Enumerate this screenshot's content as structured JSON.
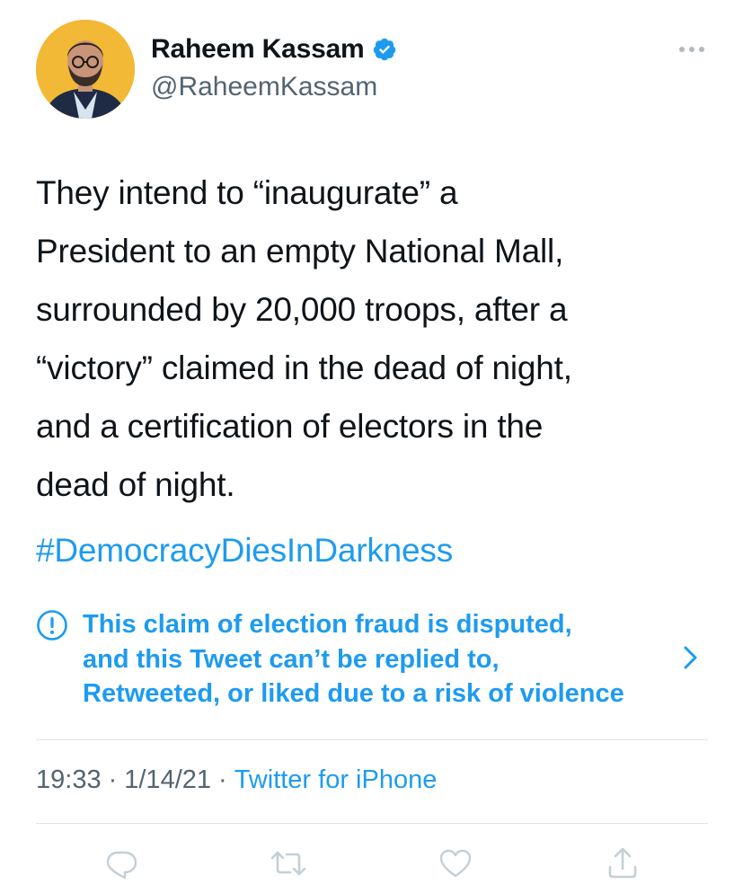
{
  "author": {
    "name": "Raheem Kassam",
    "handle": "@RaheemKassam",
    "verified": true,
    "avatar_icon": "profile-photo"
  },
  "tweet": {
    "text": "They intend to “inaugurate” a\nPresident to an empty National Mall,\nsurrounded by 20,000 troops, after a\n“victory” claimed in the dead of night,\nand a certification of electors in the\ndead of night.",
    "hashtag": "#DemocracyDiesInDarkness"
  },
  "notice": {
    "icon": "exclamation-circle-icon",
    "text": "This claim of election fraud is disputed,\nand this Tweet can’t be replied to,\nRetweeted, or liked due to a risk of violence"
  },
  "meta": {
    "time": "19:33",
    "separator": "·",
    "date": "1/14/21",
    "source": "Twitter for iPhone"
  },
  "actions": [
    "reply-icon",
    "retweet-icon",
    "like-icon",
    "share-icon"
  ],
  "colors": {
    "link": "#1d9bf0",
    "secondary_text": "#536471",
    "primary_text": "#0f1419",
    "disabled_icon": "#c4cfd6",
    "divider": "#dfe3e6",
    "avatar_background": "#f2b936"
  }
}
